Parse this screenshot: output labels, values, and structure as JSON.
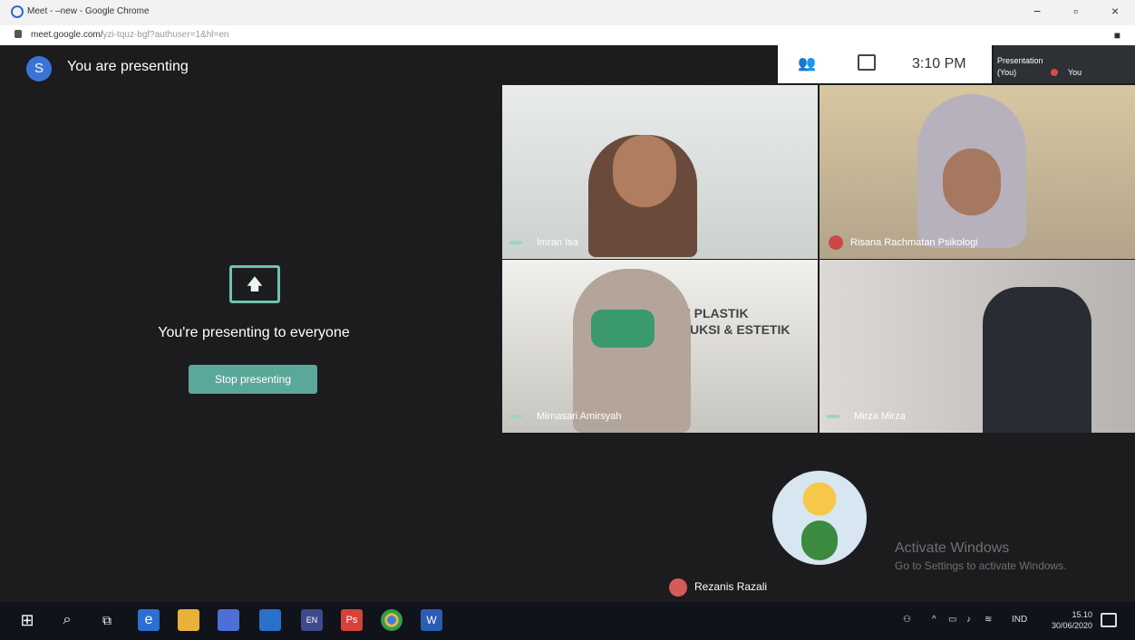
{
  "browser": {
    "title": "Meet - –new - Google Chrome",
    "url_main": "meet.google.com/",
    "url_rest": "yzi-tquz-bgf?authuser=1&hl=en",
    "minimize": "−",
    "maximize": "▫",
    "close": "×",
    "menu": "■"
  },
  "meet": {
    "avatar_initial": "S",
    "presenting_label": "You are presenting",
    "time": "3:10 PM",
    "people_icon_glyph": "👥",
    "presentation_thumb": {
      "line1": "Presentation",
      "line2": "(You)",
      "you": "You"
    },
    "share_message": "You're presenting to everyone",
    "stop_button": "Stop presenting",
    "share_icon_glyph": "🡅"
  },
  "participants": [
    {
      "name": "Imran Isa",
      "muted": false
    },
    {
      "name": "Risana Rachmatan Psikologi",
      "muted": true
    },
    {
      "name": "Mirnasari Amirsyah",
      "muted": false,
      "banner_line1": "BEDAH PLASTIK",
      "banner_line2": "ONSTRUKSI & ESTETIK"
    },
    {
      "name": "Mirza Mirza",
      "muted": false
    }
  ],
  "self_tile": {
    "name": "Rezanis Razali"
  },
  "watermark": {
    "line1": "Activate Windows",
    "line2": "Go to Settings to activate Windows."
  },
  "taskbar": {
    "en_label": "EN",
    "ps_label": "Ps",
    "word_label": "W",
    "edge_label": "e",
    "lang": "IND",
    "time": "15.10",
    "date": "30/06/2020"
  }
}
